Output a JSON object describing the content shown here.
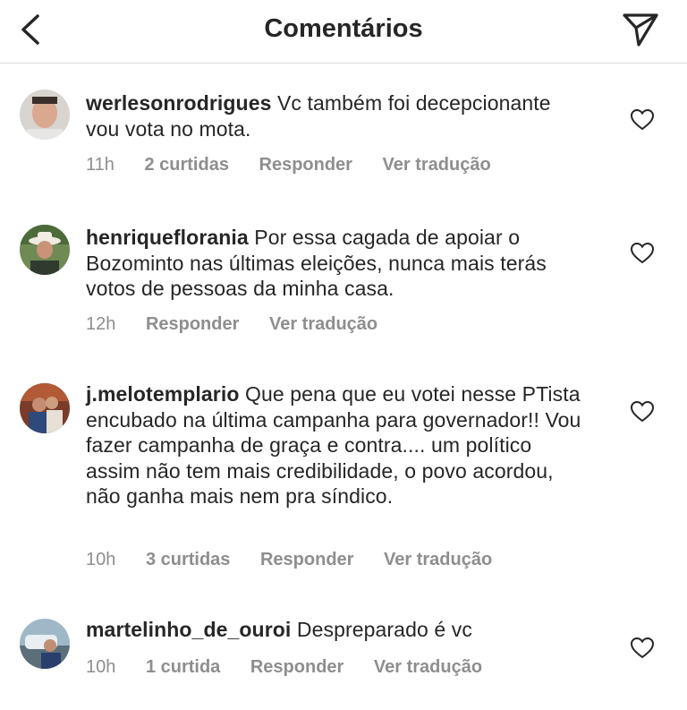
{
  "header": {
    "title": "Comentários",
    "back_icon": "chevron-left-icon",
    "share_icon": "paper-plane-icon"
  },
  "comments": [
    {
      "username": "werlesonrodrigues",
      "text": "Vc também foi decepcionante vou vota no mota.",
      "time": "11h",
      "likes": "2 curtidas",
      "reply": "Responder",
      "translate": "Ver tradução"
    },
    {
      "username": "henriqueflorania",
      "text": "Por essa cagada de apoiar o Bozominto nas últimas eleições, nunca mais terás votos de pessoas da minha casa.",
      "time": "12h",
      "likes": "",
      "reply": "Responder",
      "translate": "Ver tradução"
    },
    {
      "username": "j.melotemplario",
      "text": "Que pena que eu votei nesse PTista encubado na última campanha para governador!! Vou fazer campanha de graça e contra.... um político assim não tem mais credibilidade, o povo acordou, não ganha mais nem pra síndico.",
      "time": "10h",
      "likes": "3 curtidas",
      "reply": "Responder",
      "translate": "Ver tradução"
    },
    {
      "username": "martelinho_de_ouroi",
      "text": "Despreparado é vc",
      "time": "10h",
      "likes": "1 curtida",
      "reply": "Responder",
      "translate": "Ver tradução"
    }
  ]
}
